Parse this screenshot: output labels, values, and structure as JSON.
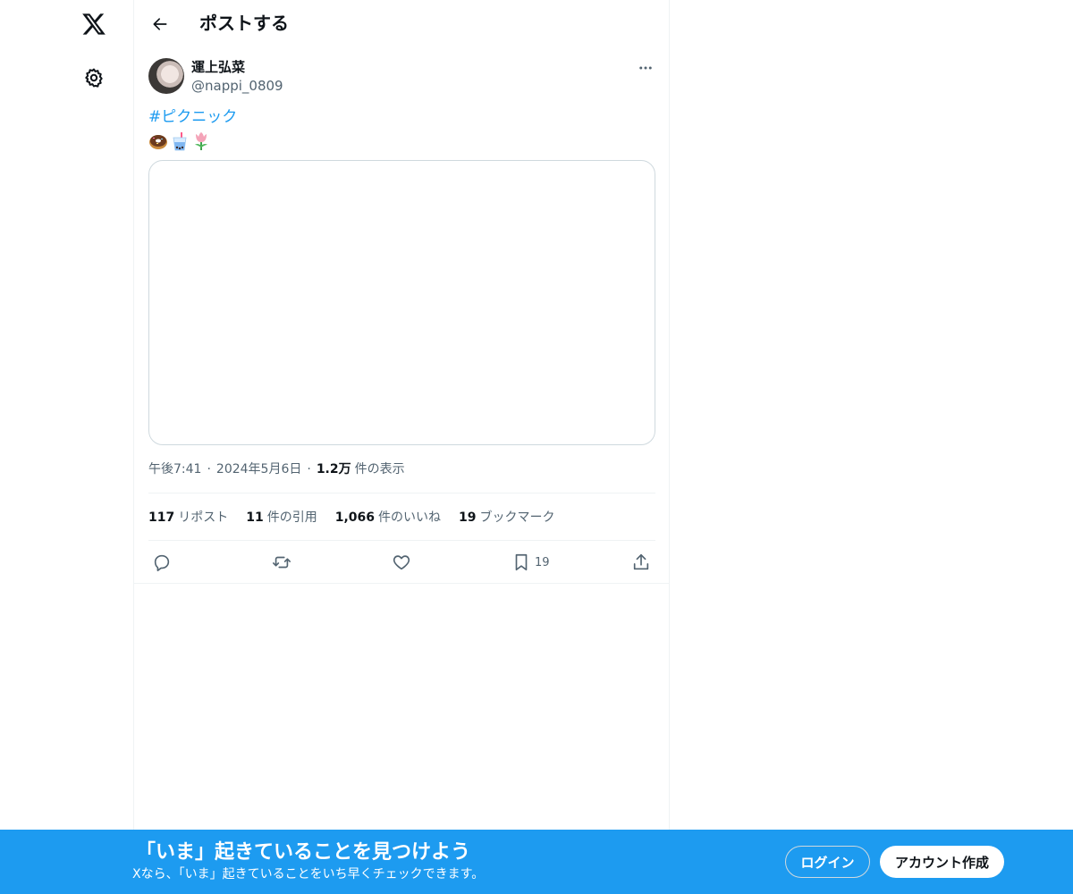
{
  "nav": {
    "logo_icon": "x-logo-icon",
    "settings_icon": "gear-icon"
  },
  "header": {
    "title": "ポストする",
    "back_icon": "arrow-left-icon"
  },
  "post": {
    "author_name": "運上弘菜",
    "author_handle": "@nappi_0809",
    "hashtag": "#ピクニック",
    "emojis": [
      "doughnut",
      "bubble-tea",
      "tulip"
    ],
    "time": "午後7:41",
    "date": "2024年5月6日",
    "views_count": "1.2万",
    "views_label": "件の表示",
    "dot": "·"
  },
  "stats": [
    {
      "num": "117",
      "label": "リポスト"
    },
    {
      "num": "11",
      "label": "件の引用"
    },
    {
      "num": "1,066",
      "label": "件のいいね"
    },
    {
      "num": "19",
      "label": "ブックマーク"
    }
  ],
  "actions": {
    "bookmark_count": "19"
  },
  "banner": {
    "title": "「いま」起きていることを見つけよう",
    "subtitle": "Xなら、「いま」起きていることをいち早くチェックできます。",
    "login_label": "ログイン",
    "signup_label": "アカウント作成"
  },
  "colors": {
    "accent": "#1d9bf0",
    "text_primary": "#0f1419",
    "text_secondary": "#536471",
    "border": "#eff3f4"
  }
}
